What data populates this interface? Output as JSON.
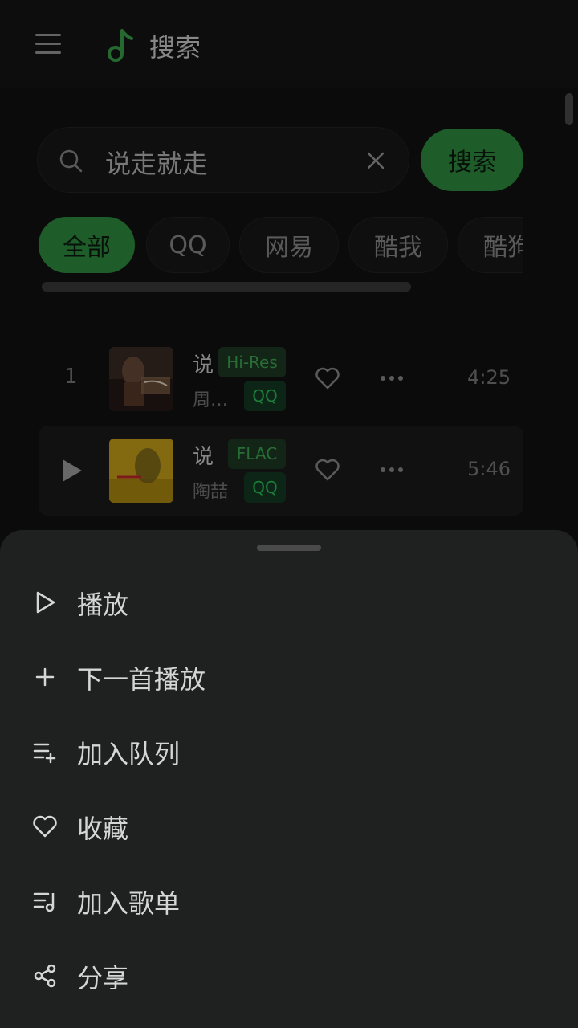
{
  "header": {
    "title": "搜索",
    "icons": [
      "menu-icon",
      "music-note-icon"
    ]
  },
  "search": {
    "query": "说走就走",
    "button_label": "搜索"
  },
  "filters": [
    "全部",
    "QQ",
    "网易",
    "酷我",
    "酷狗"
  ],
  "songs": [
    {
      "index": "1",
      "title": "说",
      "artist": "周…",
      "quality": "Hi-Res",
      "source": "QQ",
      "duration": "4:25"
    },
    {
      "index": "",
      "title": "说",
      "artist": "陶喆",
      "quality": "FLAC",
      "source": "QQ",
      "duration": "5:46"
    }
  ],
  "sheet": {
    "items": [
      {
        "label": "播放",
        "icon": "play-outline-icon"
      },
      {
        "label": "下一首播放",
        "icon": "plus-icon"
      },
      {
        "label": "加入队列",
        "icon": "queue-add-icon"
      },
      {
        "label": "收藏",
        "icon": "heart-icon"
      },
      {
        "label": "加入歌单",
        "icon": "playlist-add-icon"
      },
      {
        "label": "分享",
        "icon": "share-icon"
      }
    ]
  },
  "colors": {
    "accent": "#2f8f3f",
    "background": "#121212",
    "sheet": "#1f2020"
  }
}
